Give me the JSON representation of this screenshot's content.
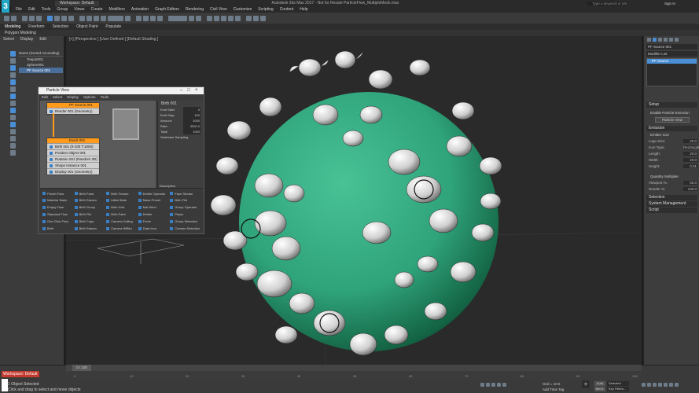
{
  "app": {
    "title": "Autodesk 3ds Max 2017 - Not for Resale   ParticleFlow_MultipleMesh.max",
    "workspace_selector": "Workspace: Default",
    "search_placeholder": "Type a keyword or phrase",
    "user": "Sign In"
  },
  "menu": [
    "File",
    "Edit",
    "Tools",
    "Group",
    "Views",
    "Create",
    "Modifiers",
    "Animation",
    "Graph Editors",
    "Rendering",
    "Civil View",
    "Customize",
    "Scripting",
    "Content",
    "Help"
  ],
  "ribbon_tabs": [
    "Modeling",
    "Freeform",
    "Selection",
    "Object Paint",
    "Populate"
  ],
  "ribbon_subtitle": "Polygon Modeling",
  "scene_explorer": {
    "tabs": [
      "Select",
      "Display",
      "Edit"
    ],
    "column_header": "Name (Sorted Ascending)",
    "items": [
      "Teapot001",
      "Sphere001",
      "PF Source 001"
    ]
  },
  "viewport": {
    "label": "[+] [Perspective ] [User Defined ] [Default Shading ]"
  },
  "particle_view": {
    "title": "Particle View",
    "menu": [
      "Edit",
      "Select",
      "Display",
      "Options",
      "Tools"
    ],
    "source_node": {
      "title": "PF Source 001",
      "ops": [
        "Render 001 (Geometry)"
      ]
    },
    "event_node": {
      "title": "Event 001",
      "ops": [
        "Birth 001 (0-100 T:1000)",
        "Position Object 001 (Sphere001)",
        "Rotation 001 (Random 3D)",
        "Shape Instance 001 (Teapot001)",
        "Display 001 (Geometry)"
      ]
    },
    "params": {
      "title": "Birth 001",
      "rows": [
        {
          "label": "Emit Start:",
          "value": "0"
        },
        {
          "label": "Emit Stop:",
          "value": "100"
        },
        {
          "label": "Amount:",
          "value": "1000"
        },
        {
          "label": "Rate:",
          "value": "3000.0"
        },
        {
          "label": "Total:",
          "value": "1000"
        }
      ],
      "subframe": "Subframe Sampling",
      "description_label": "Description"
    },
    "depot": [
      "Preset Flow",
      "Birth Paint",
      "Birth Texture",
      "Delete Operator",
      "Face Stream",
      "Material Static",
      "Birth Stream",
      "Initial State",
      "Mass Preset",
      "Birth File",
      "Empty Flow",
      "Birth Group",
      "Birth Grid",
      "Mat Wind",
      "Group Operator",
      "Standard Flow",
      "Birth File",
      "Birth Paint",
      "Delete",
      "Physx",
      "One Click Flow",
      "Birth Copy",
      "Camera Culling",
      "Force",
      "Group Selection",
      "Birth",
      "Birth Stream",
      "Camera IMBlur",
      "Data Icon",
      "Camera Selection"
    ]
  },
  "command_panel": {
    "object_name": "PF Source 001",
    "modifier_list": "Modifier List",
    "stack_item": "PF Source",
    "sections": {
      "setup": "Setup",
      "enable": "Enable Particle Emission",
      "particle_view_button": "Particle View",
      "emission": "Emission",
      "emitter_icon": "Emitter Icon",
      "selection": "Selection",
      "system_management": "System Management",
      "script": "Script"
    },
    "emission_rows": [
      {
        "label": "Logo Size:",
        "value": "20.0"
      },
      {
        "label": "Icon Type:",
        "value": "Rectangle"
      },
      {
        "label": "Length:",
        "value": "20.0"
      },
      {
        "label": "Width:",
        "value": "20.0"
      },
      {
        "label": "Height:",
        "value": "0.01"
      }
    ],
    "quantity_label": "Quantity Multiplier",
    "viewport_pct": {
      "label": "Viewport %:",
      "value": "50.0"
    },
    "render_pct": {
      "label": "Render %:",
      "value": "100.0"
    }
  },
  "timeline": {
    "frame_display": "0 / 100",
    "ticks": [
      "0",
      "10",
      "20",
      "30",
      "40",
      "50",
      "60",
      "70",
      "80",
      "90",
      "100"
    ]
  },
  "status": {
    "selection": "1 Object Selected",
    "prompt": "Click and drag to select and move objects",
    "workspace": "Workspace: Default",
    "maxscript": "MAXScript",
    "add_time_tag": "Add Time Tag",
    "auto": "Auto",
    "selected": "Selected",
    "set_key": "Set K.",
    "key_filters": "Key Filters...",
    "grid": "Grid = 10.0"
  },
  "colors": {
    "sphere": "#2fa37a",
    "teapot": "#d9d9d9",
    "node_header": "#ff9a1a",
    "accent": "#4a8fd6",
    "workspace_badge": "#c43a2e"
  }
}
